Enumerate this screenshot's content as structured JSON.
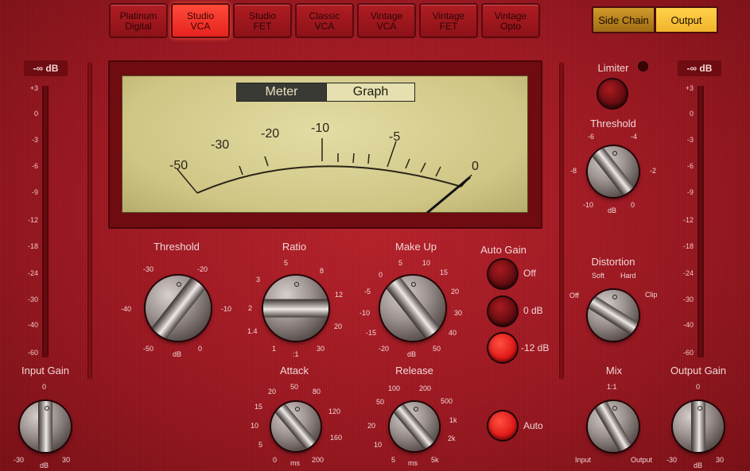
{
  "models": [
    {
      "label": "Platinum\nDigital",
      "active": false
    },
    {
      "label": "Studio\nVCA",
      "active": true
    },
    {
      "label": "Studio\nFET",
      "active": false
    },
    {
      "label": "Classic\nVCA",
      "active": false
    },
    {
      "label": "Vintage\nVCA",
      "active": false
    },
    {
      "label": "Vintage\nFET",
      "active": false
    },
    {
      "label": "Vintage\nOpto",
      "active": false
    }
  ],
  "top": {
    "side_chain": "Side Chain",
    "output": "Output"
  },
  "input_meter": {
    "readout": "-∞ dB",
    "scale": [
      "+3",
      "0",
      "-3",
      "-6",
      "-9",
      "-12",
      "-18",
      "-24",
      "-30",
      "-40",
      "-60"
    ]
  },
  "output_meter": {
    "readout": "-∞ dB",
    "scale": [
      "+3",
      "0",
      "-3",
      "-6",
      "-9",
      "-12",
      "-18",
      "-24",
      "-30",
      "-40",
      "-60"
    ]
  },
  "display": {
    "tab_meter": "Meter",
    "tab_graph": "Graph",
    "scale": [
      "-50",
      "-30",
      "-20",
      "-10",
      "-5",
      "0"
    ]
  },
  "threshold": {
    "label": "Threshold",
    "ticks": [
      "-30",
      "-20",
      "-40",
      "-10",
      "-50",
      "0"
    ],
    "unit": "dB"
  },
  "ratio": {
    "label": "Ratio",
    "ticks": [
      "5",
      "3",
      "8",
      "2",
      "12",
      "1.4",
      "20",
      "1",
      "30"
    ],
    "unit": ":1"
  },
  "makeup": {
    "label": "Make Up",
    "ticks": [
      "5",
      "10",
      "0",
      "15",
      "-5",
      "20",
      "-10",
      "30",
      "-15",
      "40",
      "-20",
      "50"
    ],
    "unit": "dB"
  },
  "autogain": {
    "label": "Auto Gain",
    "off": "Off",
    "zero": "0 dB",
    "minus12": "-12 dB",
    "auto": "Auto"
  },
  "attack": {
    "label": "Attack",
    "ticks": [
      "20",
      "50",
      "80",
      "15",
      "120",
      "10",
      "160",
      "5",
      "0",
      "200"
    ],
    "unit": "ms"
  },
  "release": {
    "label": "Release",
    "ticks": [
      "100",
      "200",
      "50",
      "500",
      "1k",
      "20",
      "2k",
      "10",
      "5",
      "5k"
    ],
    "unit": "ms"
  },
  "input_gain": {
    "label": "Input Gain",
    "ticks": [
      "0",
      "-30",
      "30"
    ],
    "unit": "dB"
  },
  "limiter": {
    "label": "Limiter"
  },
  "limiter_threshold": {
    "label": "Threshold",
    "ticks": [
      "-6",
      "-4",
      "-8",
      "-2",
      "-10",
      "0"
    ],
    "unit": "dB"
  },
  "distortion": {
    "label": "Distortion",
    "ticks": [
      "Soft",
      "Hard",
      "Off",
      "Clip"
    ]
  },
  "mix": {
    "label": "Mix",
    "ticks": [
      "1:1",
      "Input",
      "Output"
    ]
  },
  "output_gain": {
    "label": "Output Gain",
    "ticks": [
      "0",
      "-30",
      "30"
    ],
    "unit": "dB"
  }
}
